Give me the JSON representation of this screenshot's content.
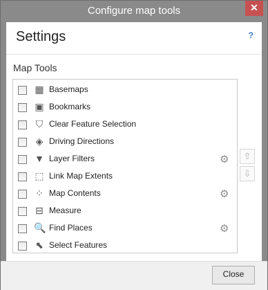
{
  "window": {
    "title": "Configure map tools",
    "close_glyph": "✕"
  },
  "header": {
    "title": "Settings",
    "help": "?"
  },
  "section": {
    "label": "Map Tools"
  },
  "tools": [
    {
      "label": "Basemaps",
      "icon": "basemap-icon",
      "glyph": "▦",
      "has_settings": false
    },
    {
      "label": "Bookmarks",
      "icon": "bookmarks-icon",
      "glyph": "▣",
      "has_settings": false
    },
    {
      "label": "Clear Feature Selection",
      "icon": "clear-selection-icon",
      "glyph": "⛉",
      "has_settings": false
    },
    {
      "label": "Driving Directions",
      "icon": "directions-icon",
      "glyph": "◈",
      "has_settings": false
    },
    {
      "label": "Layer Filters",
      "icon": "filter-icon",
      "glyph": "▼",
      "has_settings": true
    },
    {
      "label": "Link Map Extents",
      "icon": "link-extents-icon",
      "glyph": "⬚",
      "has_settings": false
    },
    {
      "label": "Map Contents",
      "icon": "map-contents-icon",
      "glyph": "⁘",
      "has_settings": true
    },
    {
      "label": "Measure",
      "icon": "measure-icon",
      "glyph": "⊟",
      "has_settings": false
    },
    {
      "label": "Find Places",
      "icon": "search-icon",
      "glyph": "🔍",
      "has_settings": true
    },
    {
      "label": "Select Features",
      "icon": "select-features-icon",
      "glyph": "⬉",
      "has_settings": false
    }
  ],
  "controls": {
    "gear_glyph": "⚙",
    "up_glyph": "⇧",
    "down_glyph": "⇩"
  },
  "footer": {
    "close_label": "Close"
  }
}
